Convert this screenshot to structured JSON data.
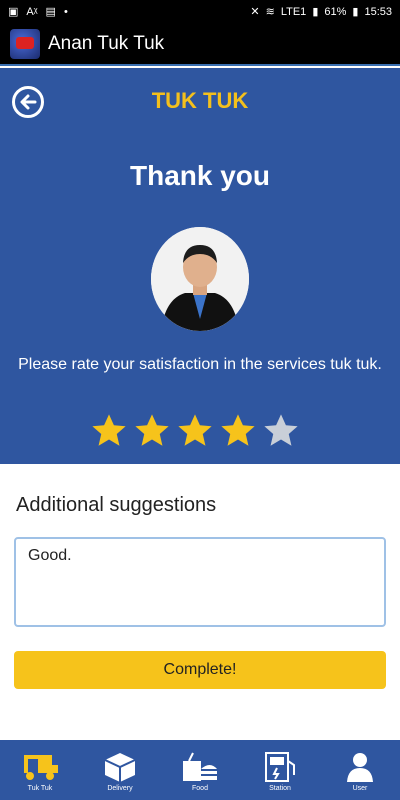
{
  "status": {
    "network": "LTE1",
    "carrier": "Vo))",
    "battery": "61%",
    "time": "15:53"
  },
  "app": {
    "title": "Anan Tuk Tuk"
  },
  "hero": {
    "title": "TUK TUK",
    "thanks": "Thank you",
    "prompt": "Please rate your satisfaction in the services tuk tuk.",
    "rating": 4,
    "max_rating": 5,
    "star_colors": {
      "filled": "#f6c31b",
      "empty": "#c9cfd8"
    }
  },
  "form": {
    "suggestion_label": "Additional suggestions",
    "suggestion_value": "Good.",
    "complete_label": "Complete!"
  },
  "nav": {
    "items": [
      {
        "label": "Tuk Tuk",
        "icon": "tuk-tuk-icon"
      },
      {
        "label": "Delivery",
        "icon": "box-icon"
      },
      {
        "label": "Food",
        "icon": "food-icon"
      },
      {
        "label": "Station",
        "icon": "station-icon"
      },
      {
        "label": "User",
        "icon": "user-icon"
      }
    ]
  },
  "colors": {
    "primary": "#2f56a0",
    "accent": "#f6c31b",
    "header": "#000000"
  }
}
